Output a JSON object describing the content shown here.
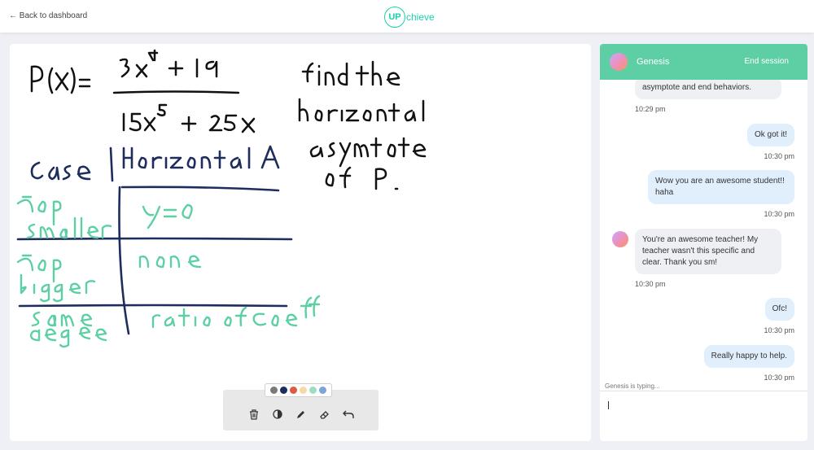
{
  "header": {
    "back_label": "← Back to dashboard",
    "logo_badge": "UP",
    "logo_text": "chieve"
  },
  "whiteboard": {
    "handwriting": {
      "equation": "P(x)= 3x⁴ + 19 / 15x⁵ + 25x",
      "prompt": "find the horizontal asymtote of P.",
      "table_header_case": "Case",
      "table_header_asymptote": "Horizontal A",
      "rows": [
        {
          "case": "top smaller",
          "asymptote": "y=0"
        },
        {
          "case": "top bigger",
          "asymptote": "none"
        },
        {
          "case": "same degee",
          "asymptote": "ratio of Coeff"
        }
      ]
    },
    "palette": [
      "#7a7a7a",
      "#1f2d5c",
      "#e05a47",
      "#f6d9a6",
      "#9fdcc4",
      "#7aa6e0"
    ],
    "tools": [
      "trash-icon",
      "contrast-icon",
      "pencil-icon",
      "eraser-icon",
      "undo-icon"
    ]
  },
  "chat": {
    "partner_name": "Genesis",
    "end_session_label": "End session",
    "messages": [
      {
        "from": "them",
        "text": "asymptote and end behaviors.",
        "time": "10:29 pm"
      },
      {
        "from": "me",
        "text": "Ok got it!",
        "time": "10:30 pm"
      },
      {
        "from": "me",
        "text": "Wow you are an awesome student!! haha",
        "time": "10:30 pm"
      },
      {
        "from": "them",
        "text": "You're an awesome teacher! My teacher wasn't this specific and clear. Thank you sm!",
        "time": "10:30 pm"
      },
      {
        "from": "me",
        "text": "Ofc!",
        "time": "10:30 pm"
      },
      {
        "from": "me",
        "text": "Really happy to help.",
        "time": "10:30 pm"
      }
    ],
    "typing_indicator": "Genesis is typing...",
    "input_value": ""
  },
  "colors": {
    "accent": "#5ecfa5",
    "ink_navy": "#1f2d5c",
    "ink_teal": "#5ccfa3"
  }
}
